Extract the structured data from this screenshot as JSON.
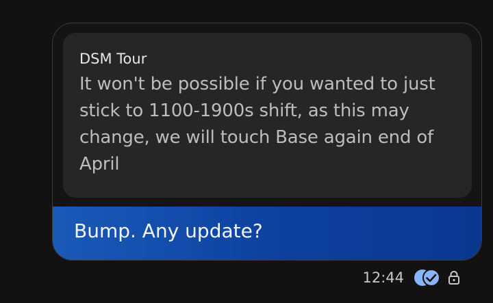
{
  "quoted_message": {
    "author": "DSM Tour",
    "text": "It won't be possible if you wanted to just stick to 1100-1900s shift, as this may change, we will touch Base again end of April"
  },
  "reply_message": {
    "text": "Bump. Any update?"
  },
  "meta": {
    "time": "12:44",
    "status_icon": "double-check-read-icon",
    "lock_icon": "lock-icon"
  },
  "colors": {
    "background": "#121212",
    "quoted_bg": "#262626",
    "reply_bg": "#0c3f9e",
    "read_indicator": "#8ab4f8"
  }
}
